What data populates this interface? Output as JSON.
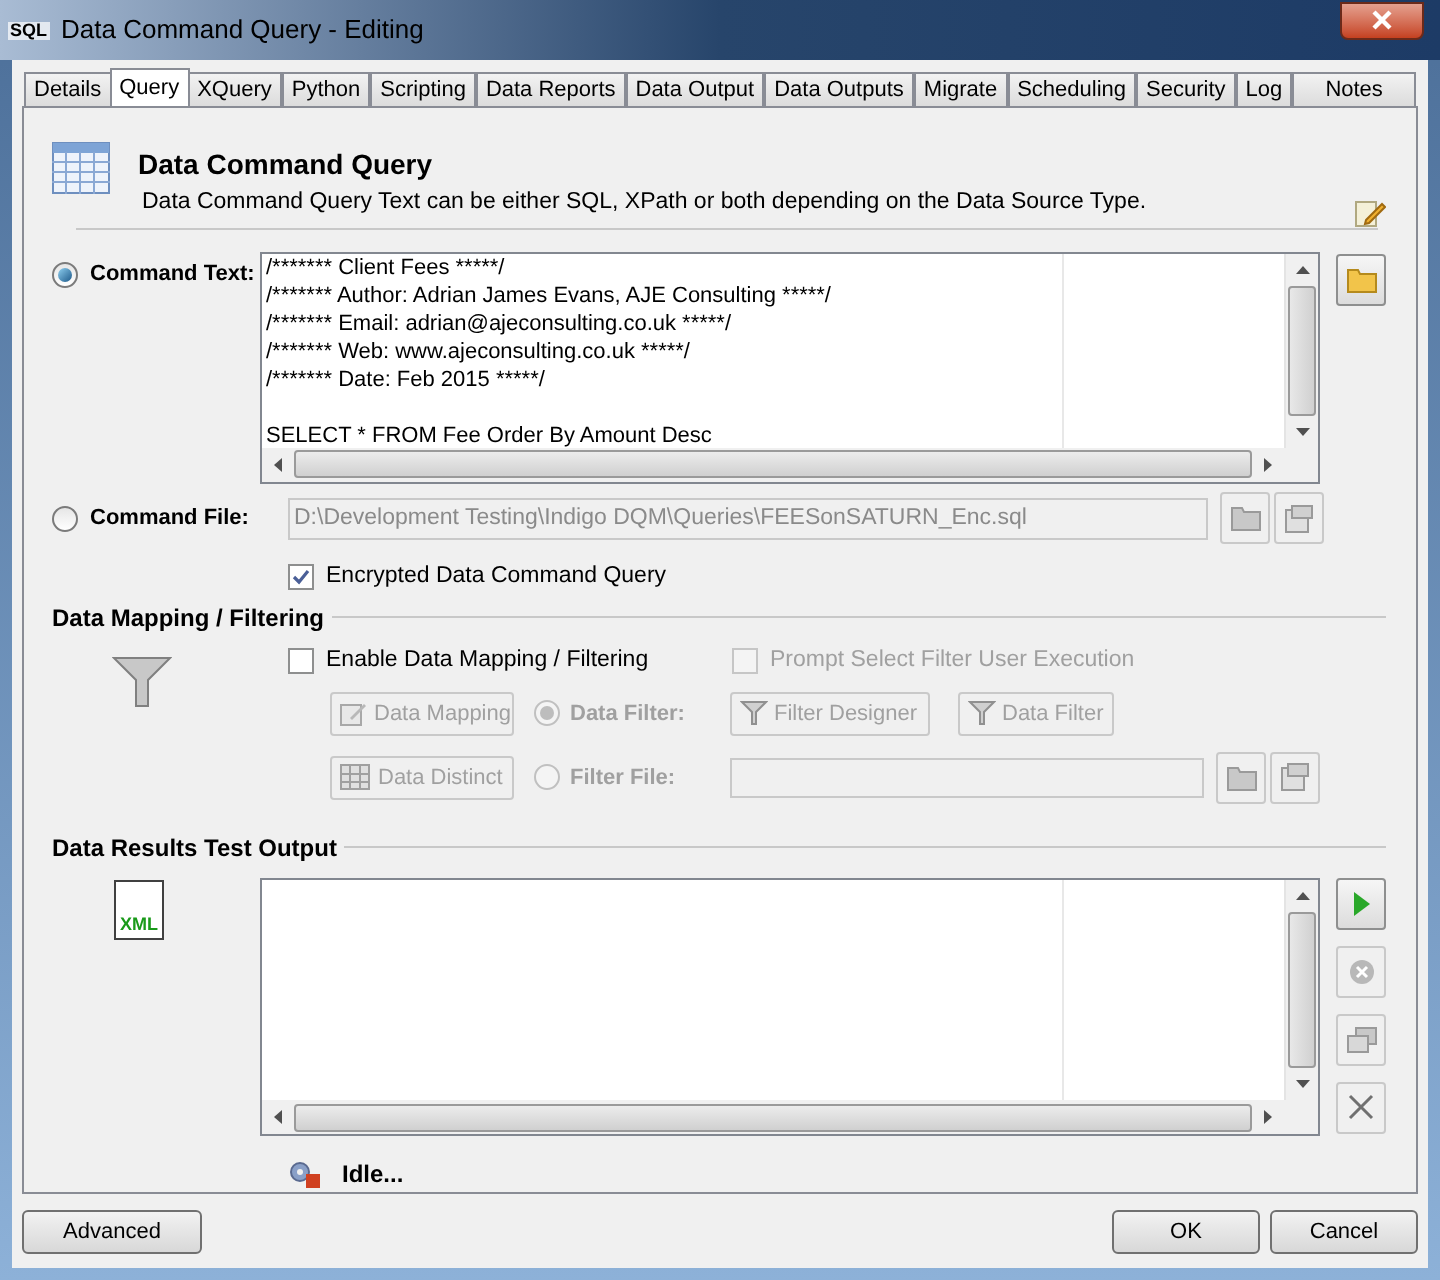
{
  "window": {
    "title": "Data Command Query - Editing",
    "icon_label": "SQL"
  },
  "tabs": [
    {
      "label": "Details",
      "selected": false
    },
    {
      "label": "Query",
      "selected": true
    },
    {
      "label": "XQuery",
      "selected": false
    },
    {
      "label": "Python",
      "selected": false
    },
    {
      "label": "Scripting",
      "selected": false
    },
    {
      "label": "Data Reports",
      "selected": false
    },
    {
      "label": "Data Output",
      "selected": false
    },
    {
      "label": "Data Outputs",
      "selected": false
    },
    {
      "label": "Migrate",
      "selected": false
    },
    {
      "label": "Scheduling",
      "selected": false
    },
    {
      "label": "Security",
      "selected": false
    },
    {
      "label": "Log",
      "selected": false
    },
    {
      "label": "Notes",
      "selected": false
    }
  ],
  "header": {
    "title": "Data Command Query",
    "description": "Data Command Query Text can be either SQL, XPath or both depending on the Data Source Type."
  },
  "command_text": {
    "label": "Command Text:",
    "selected": true,
    "comment_lines": [
      "/******* Client Fees *****/",
      "/******* Author: Adrian James Evans, AJE Consulting *****/",
      "/******* Email: adrian@ajeconsulting.co.uk *****/",
      "/******* Web: www.ajeconsulting.co.uk *****/",
      "/******* Date: Feb 2015 *****/"
    ],
    "statement": "SELECT * FROM Fee Order By Amount Desc"
  },
  "command_file": {
    "label": "Command File:",
    "selected": false,
    "value": "D:\\Development Testing\\Indigo DQM\\Queries\\FEESonSATURN_Enc.sql",
    "disabled": true
  },
  "encrypted": {
    "label": "Encrypted Data Command Query",
    "checked": true
  },
  "mapping": {
    "heading": "Data Mapping / Filtering",
    "enable": {
      "label": "Enable Data Mapping / Filtering",
      "checked": false,
      "disabled": false
    },
    "prompt": {
      "label": "Prompt Select Filter User Execution",
      "checked": false,
      "disabled": true
    },
    "data_mapping_button": "Data Mapping",
    "data_filter": {
      "label": "Data Filter:",
      "selected": true,
      "disabled": true
    },
    "filter_designer_button": "Filter Designer",
    "data_filter_button": "Data Filter",
    "data_distinct_button": "Data Distinct",
    "filter_file": {
      "label": "Filter File:",
      "selected": false,
      "disabled": true
    }
  },
  "results": {
    "heading": "Data Results Test Output",
    "icon_label": "XML",
    "status": "Idle..."
  },
  "buttons": {
    "advanced": "Advanced",
    "ok": "OK",
    "cancel": "Cancel"
  }
}
